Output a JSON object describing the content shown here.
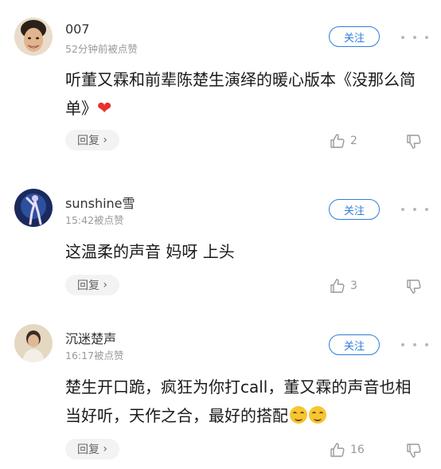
{
  "follow_label": "关注",
  "reply_label": "回复",
  "reply_chevron": "›",
  "comments": [
    {
      "username": "007",
      "meta": "52分钟前被点赞",
      "text": "听董又霖和前辈陈楚生演绎的暖心版本《没那么简单》",
      "emoji": "heart",
      "likes": "2"
    },
    {
      "username": "sunshine雪",
      "meta": "15:42被点赞",
      "text": "这温柔的声音 妈呀 上头",
      "likes": "3"
    },
    {
      "username": "沉迷楚声",
      "meta": "16:17被点赞",
      "text": "楚生开口跪，疯狂为你打call，董又霖的声音也相当好听，天作之合，最好的搭配",
      "emoji": "smile-x2",
      "likes": "16"
    }
  ],
  "icons": {
    "like": "thumbs-up-icon",
    "dislike": "thumbs-down-icon",
    "more": "more-dots-icon"
  },
  "colors": {
    "accent": "#2f7ed8",
    "heart": "#e8302c",
    "muted": "#999999"
  }
}
